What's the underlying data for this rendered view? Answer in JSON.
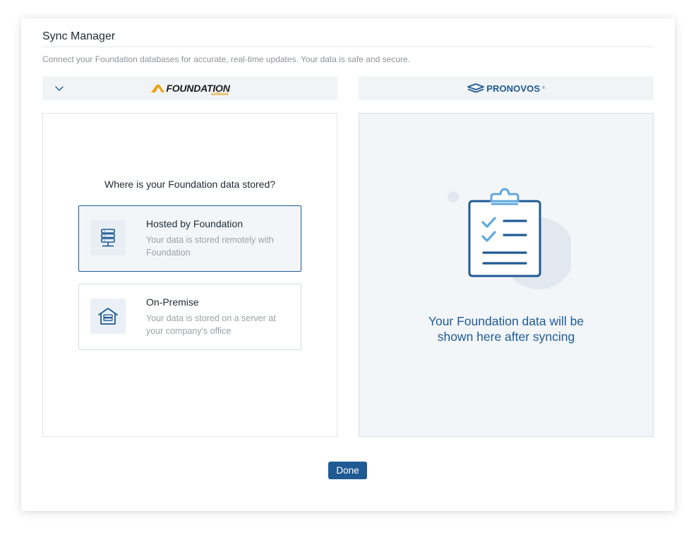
{
  "dialog": {
    "title": "Sync Manager",
    "subtitle": "Connect your Foundation databases for accurate, real-time updates. Your data is safe and secure."
  },
  "left_logo": {
    "icon": "chevron-down-icon",
    "brand_name": "FOUNDATION",
    "brand_sub": "software",
    "brand_color": "#e0a21a"
  },
  "right_logo": {
    "brand_name": "PRONOVOS",
    "brand_mark": "®",
    "brand_color": "#1f5a93"
  },
  "source_panel": {
    "question": "Where is your Foundation data stored?",
    "options": [
      {
        "title": "Hosted by Foundation",
        "description": "Your data is stored remotely with Foundation",
        "icon": "server-stack-icon",
        "selected": true
      },
      {
        "title": "On-Premise",
        "description": "Your data is stored on a server at your company's office",
        "icon": "building-server-icon",
        "selected": false
      }
    ]
  },
  "preview_panel": {
    "icon": "clipboard-checklist-icon",
    "message_line1": "Your Foundation data will be",
    "message_line2": "shown here after syncing"
  },
  "footer": {
    "done_label": "Done"
  },
  "colors": {
    "primary": "#1f5a93",
    "accent_light": "#5fa8dc",
    "muted_text": "#9aa2a9"
  }
}
